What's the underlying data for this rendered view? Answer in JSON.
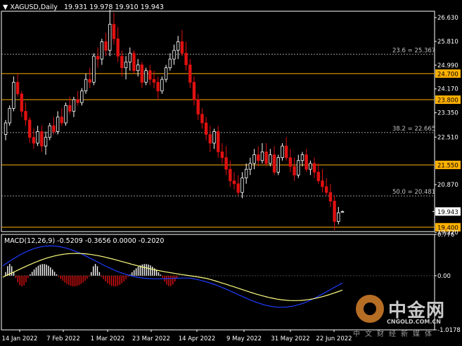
{
  "header": {
    "symbol": "XAGUSD,Daily",
    "ohlc": "19.931 19.978 19.910 19.943",
    "macd_label": "MACD(12,26,9) -0.5209 -0.3656 0.0000 -0.2020"
  },
  "colors": {
    "background": "#000000",
    "bull_candle": "#ffffff",
    "bear_candle": "#e01010",
    "level_line": "#ffb000",
    "fib_line": "#9a9a9a",
    "macd_line": "#1e3cff",
    "signal_line": "#ffff80",
    "price_tag_bg": "#ffffff",
    "level_tag_bg": "#ffb000"
  },
  "watermark": {
    "brand": "中金网",
    "url": "CNGOLD.COM.CN",
    "tagline": "中文财经新媒体"
  },
  "chart_data": [
    {
      "type": "candlestick",
      "symbol": "XAGUSD",
      "timeframe": "Daily",
      "ylim": [
        19.25,
        26.85
      ],
      "y_ticks": [
        "26.630",
        "25.810",
        "24.990",
        "24.170",
        "23.350",
        "22.510",
        "20.870",
        "19.220"
      ],
      "x_ticks": [
        "14 Jan 2022",
        "7 Feb 2022",
        "1 Mar 2022",
        "23 Mar 2022",
        "14 Apr 2022",
        "9 May 2022",
        "31 May 2022",
        "22 Jun 2022"
      ],
      "current_price": "19.943",
      "horizontal_levels": [
        "24.700",
        "23.800",
        "21.550",
        "19.400"
      ],
      "fib_levels": [
        {
          "label": "23.6 = 25.367",
          "value": 25.367
        },
        {
          "label": "38.2 = 22.665",
          "value": 22.665
        },
        {
          "label": "50.0 = 20.481",
          "value": 20.481
        }
      ],
      "candles": [
        [
          22.6,
          23.1,
          22.4,
          23.0
        ],
        [
          23.0,
          23.6,
          22.9,
          23.5
        ],
        [
          23.5,
          24.6,
          23.4,
          24.4
        ],
        [
          24.4,
          24.7,
          23.9,
          24.0
        ],
        [
          24.0,
          24.1,
          23.2,
          23.4
        ],
        [
          23.4,
          23.7,
          22.9,
          23.1
        ],
        [
          23.1,
          23.2,
          22.3,
          22.5
        ],
        [
          22.5,
          22.8,
          22.1,
          22.3
        ],
        [
          22.3,
          22.9,
          22.2,
          22.7
        ],
        [
          22.7,
          22.9,
          22.0,
          22.2
        ],
        [
          22.2,
          22.7,
          21.9,
          22.5
        ],
        [
          22.5,
          23.0,
          22.4,
          22.9
        ],
        [
          22.9,
          23.2,
          22.6,
          22.7
        ],
        [
          22.7,
          23.4,
          22.6,
          23.2
        ],
        [
          23.2,
          23.5,
          22.9,
          23.0
        ],
        [
          23.0,
          23.7,
          22.9,
          23.6
        ],
        [
          23.6,
          23.9,
          23.3,
          23.4
        ],
        [
          23.4,
          23.9,
          23.2,
          23.8
        ],
        [
          23.8,
          24.1,
          23.6,
          23.7
        ],
        [
          23.7,
          24.2,
          23.6,
          24.1
        ],
        [
          24.1,
          24.7,
          24.0,
          24.5
        ],
        [
          24.5,
          24.9,
          24.2,
          24.4
        ],
        [
          24.4,
          25.4,
          24.3,
          25.3
        ],
        [
          25.3,
          25.6,
          24.9,
          25.2
        ],
        [
          25.2,
          25.9,
          25.0,
          25.8
        ],
        [
          25.8,
          26.1,
          25.3,
          25.5
        ],
        [
          25.5,
          26.9,
          25.3,
          26.4
        ],
        [
          26.4,
          26.8,
          25.7,
          25.9
        ],
        [
          25.9,
          26.3,
          25.1,
          25.3
        ],
        [
          25.3,
          25.5,
          24.6,
          24.9
        ],
        [
          24.9,
          25.3,
          24.5,
          25.1
        ],
        [
          25.1,
          25.6,
          24.8,
          25.4
        ],
        [
          25.4,
          25.5,
          24.7,
          24.8
        ],
        [
          24.8,
          25.2,
          24.6,
          25.0
        ],
        [
          25.0,
          25.1,
          24.2,
          24.4
        ],
        [
          24.4,
          24.9,
          24.3,
          24.8
        ],
        [
          24.8,
          25.0,
          24.3,
          24.5
        ],
        [
          24.5,
          24.8,
          24.2,
          24.4
        ],
        [
          24.4,
          24.6,
          23.8,
          24.1
        ],
        [
          24.1,
          24.6,
          24.0,
          24.5
        ],
        [
          24.5,
          25.0,
          24.4,
          24.9
        ],
        [
          24.9,
          25.4,
          24.8,
          25.2
        ],
        [
          25.2,
          25.7,
          25.0,
          25.5
        ],
        [
          25.5,
          26.0,
          25.2,
          25.8
        ],
        [
          25.8,
          26.2,
          25.3,
          25.4
        ],
        [
          25.4,
          25.8,
          24.8,
          25.0
        ],
        [
          25.0,
          25.2,
          24.2,
          24.4
        ],
        [
          24.4,
          24.6,
          23.6,
          23.8
        ],
        [
          23.8,
          24.0,
          23.1,
          23.3
        ],
        [
          23.3,
          23.5,
          22.8,
          23.0
        ],
        [
          23.0,
          23.2,
          22.4,
          22.6
        ],
        [
          22.6,
          22.9,
          22.0,
          22.3
        ],
        [
          22.3,
          22.8,
          22.1,
          22.7
        ],
        [
          22.7,
          22.9,
          21.8,
          22.0
        ],
        [
          22.0,
          22.3,
          21.6,
          21.8
        ],
        [
          21.8,
          22.2,
          21.2,
          21.4
        ],
        [
          21.4,
          21.7,
          20.8,
          21.0
        ],
        [
          21.0,
          21.3,
          20.7,
          20.9
        ],
        [
          20.9,
          21.2,
          20.5,
          20.6
        ],
        [
          20.6,
          21.3,
          20.4,
          21.1
        ],
        [
          21.1,
          21.6,
          20.9,
          21.4
        ],
        [
          21.4,
          21.8,
          21.2,
          21.6
        ],
        [
          21.6,
          22.1,
          21.4,
          21.9
        ],
        [
          21.9,
          22.2,
          21.5,
          21.7
        ],
        [
          21.7,
          22.3,
          21.6,
          22.0
        ],
        [
          22.0,
          22.3,
          21.5,
          21.6
        ],
        [
          21.6,
          22.1,
          21.5,
          21.9
        ],
        [
          21.9,
          22.2,
          21.2,
          21.3
        ],
        [
          21.3,
          21.9,
          21.2,
          21.8
        ],
        [
          21.8,
          22.3,
          21.7,
          22.2
        ],
        [
          22.2,
          22.5,
          21.7,
          21.8
        ],
        [
          21.8,
          22.1,
          21.3,
          21.5
        ],
        [
          21.5,
          21.8,
          21.0,
          21.2
        ],
        [
          21.2,
          21.9,
          21.1,
          21.7
        ],
        [
          21.7,
          22.0,
          21.5,
          21.9
        ],
        [
          21.9,
          22.1,
          21.3,
          21.4
        ],
        [
          21.4,
          21.7,
          21.2,
          21.6
        ],
        [
          21.6,
          21.8,
          21.1,
          21.3
        ],
        [
          21.3,
          21.6,
          20.9,
          21.0
        ],
        [
          21.0,
          21.4,
          20.6,
          20.8
        ],
        [
          20.8,
          21.1,
          20.5,
          20.6
        ],
        [
          20.6,
          20.9,
          20.1,
          20.3
        ],
        [
          20.3,
          20.5,
          19.3,
          19.6
        ],
        [
          19.6,
          20.1,
          19.5,
          19.9
        ],
        [
          19.931,
          19.978,
          19.91,
          19.943
        ]
      ]
    },
    {
      "type": "macd",
      "params": "12,26,9",
      "ylim": [
        -1.0178,
        0.776
      ],
      "y_ticks": [
        "0.776",
        "0.00",
        "-1.0178"
      ],
      "macd": -0.5209,
      "signal": -0.3656,
      "histogram_sign_runs": [
        {
          "sign": 1,
          "bars": 5
        },
        {
          "sign": -1,
          "bars": 7
        },
        {
          "sign": 1,
          "bars": 14
        },
        {
          "sign": -1,
          "bars": 16
        },
        {
          "sign": 1,
          "bars": 5
        },
        {
          "sign": -1,
          "bars": 14
        },
        {
          "sign": 1,
          "bars": 16
        },
        {
          "sign": -1,
          "bars": 8
        }
      ]
    }
  ]
}
